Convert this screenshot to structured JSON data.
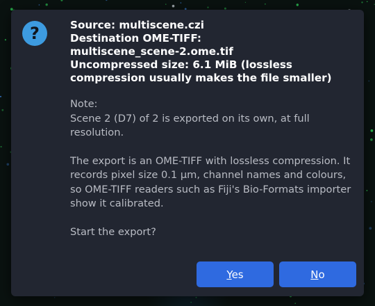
{
  "dialog": {
    "icon": "question-icon",
    "icon_glyph": "?",
    "headline": {
      "source": "Source: multiscene.czi",
      "destination_label": "Destination OME-TIFF:",
      "destination_file": "multiscene_scene-2.ome.tif",
      "size_line1": "Uncompressed size: 6.1 MiB (lossless",
      "size_line2": "compression usually makes the file smaller)"
    },
    "body": {
      "note_title": "Note:",
      "note_text": "Scene 2 (D7) of 2 is exported on its own, at full resolution.",
      "export_text": "The export is an OME-TIFF with lossless compression. It records pixel size 0.1 µm, channel names and colours, so OME-TIFF readers such as Fiji's Bio-Formats importer show it calibrated.",
      "prompt": "Start the export?"
    },
    "buttons": {
      "yes_mnemonic": "Y",
      "yes_rest": "es",
      "no_mnemonic": "N",
      "no_rest": "o"
    }
  },
  "colors": {
    "dialog_bg": "#222631",
    "button_bg": "#2f6ae0",
    "icon_bg": "#3d9be0",
    "body_text": "#b9bcc4"
  }
}
